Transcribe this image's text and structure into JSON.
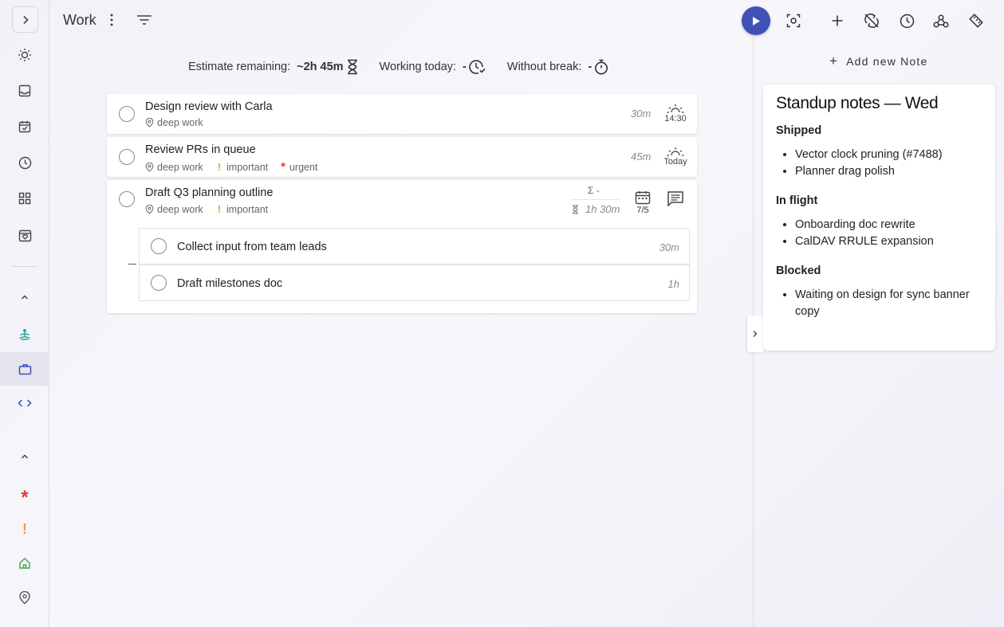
{
  "header": {
    "project_title": "Work"
  },
  "metrics": {
    "estimate_label": "Estimate remaining:",
    "estimate_value": "~2h 45m",
    "working_label": "Working today:",
    "working_value": "-",
    "break_label": "Without break:",
    "break_value": "-"
  },
  "tasks": [
    {
      "title": "Design review with Carla",
      "tags": [
        {
          "name": "deep work",
          "icon": "tag-icon"
        }
      ],
      "estimate": "30m",
      "due": "14:30"
    },
    {
      "title": "Review PRs in queue",
      "tags": [
        {
          "name": "deep work",
          "icon": "tag-icon"
        },
        {
          "name": "important",
          "icon": "exclamation-icon"
        },
        {
          "name": "urgent",
          "icon": "asterisk-icon"
        }
      ],
      "estimate": "45m",
      "due": "Today"
    },
    {
      "title": "Draft Q3 planning outline",
      "tags": [
        {
          "name": "deep work",
          "icon": "tag-icon"
        },
        {
          "name": "important",
          "icon": "exclamation-icon"
        }
      ],
      "sum_label": "Σ -",
      "estimate": "1h 30m",
      "repeat_date": "7/5",
      "subtasks": [
        {
          "title": "Collect input from team leads",
          "estimate": "30m"
        },
        {
          "title": "Draft milestones doc",
          "estimate": "1h"
        }
      ]
    }
  ],
  "notes": {
    "add_label": "Add new Note",
    "card": {
      "title": "Standup notes — Wed",
      "sections": [
        {
          "heading": "Shipped",
          "items": [
            "Vector clock pruning (#7488)",
            "Planner drag polish"
          ]
        },
        {
          "heading": "In flight",
          "items": [
            "Onboarding doc rewrite",
            "CalDAV RRULE expansion"
          ]
        },
        {
          "heading": "Blocked",
          "items": [
            "Waiting on design for sync banner copy"
          ]
        }
      ]
    }
  },
  "colors": {
    "accent": "#3f51b5",
    "important": "#f0a020",
    "urgent": "#e53935",
    "home_tag": "#43a047",
    "meditation_tag": "#26a69a"
  }
}
